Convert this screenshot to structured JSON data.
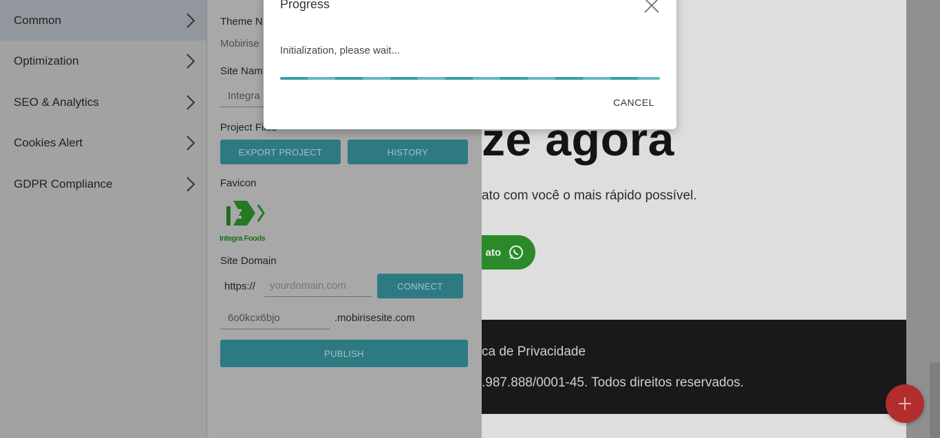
{
  "menu": {
    "items": [
      {
        "label": "Common",
        "active": true
      },
      {
        "label": "Optimization",
        "active": false
      },
      {
        "label": "SEO & Analytics",
        "active": false
      },
      {
        "label": "Cookies Alert",
        "active": false
      },
      {
        "label": "GDPR Compliance",
        "active": false
      }
    ],
    "chevron_icon": "chevron-right-icon"
  },
  "panel": {
    "theme_label": "Theme N",
    "theme_value": "Mobirise",
    "site_name_label": "Site Nam",
    "site_name_value": "Integra",
    "project_files_label": "Project Files",
    "export_button": "EXPORT PROJECT",
    "history_button": "HISTORY",
    "favicon_label": "Favicon",
    "favicon_logo_text": "Integra Foods",
    "site_domain_label": "Site Domain",
    "https_prefix": "https://",
    "domain_placeholder": "yourdomain.com",
    "connect_button": "CONNECT",
    "subdomain_value": "6o0kcx6bjo",
    "subdomain_suffix": ".mobirisesite.com",
    "publish_button": "PUBLISH"
  },
  "dialog": {
    "title": "Progress",
    "message": "Initialization, please wait...",
    "cancel_button": "CANCEL",
    "close_icon": "close-icon"
  },
  "site": {
    "hero_title": "ze agora",
    "hero_subtitle": "ato com você o mais rápido possível.",
    "whatsapp_button": "ato",
    "footer_line1": "ca de Privacidade",
    "footer_line2": ".987.888/0001-45. Todos direitos reservados."
  },
  "colors": {
    "accent": "#2e7a82",
    "progress": "#3a9da7",
    "fab": "#b22e2e",
    "whatsapp": "#2a8a2a"
  }
}
